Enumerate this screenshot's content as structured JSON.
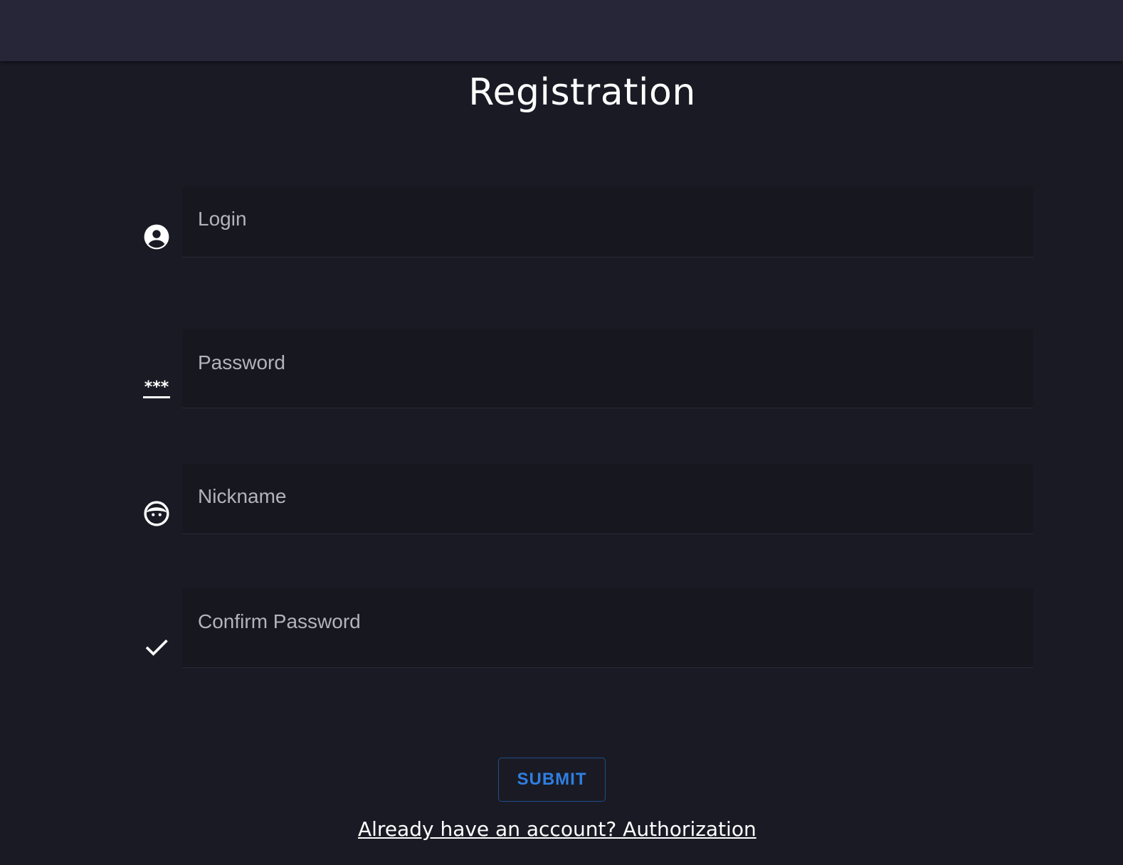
{
  "page": {
    "title": "Registration"
  },
  "form": {
    "fields": [
      {
        "label": "Login",
        "icon": "account-circle-icon"
      },
      {
        "label": "Password",
        "icon": "password-icon"
      },
      {
        "label": "Nickname",
        "icon": "face-icon"
      },
      {
        "label": "Confirm Password",
        "icon": "check-icon"
      }
    ],
    "submit_label": "SUBMIT",
    "auth_link": "Already have an account? Authorization"
  },
  "colors": {
    "background": "#1a1a25",
    "top_bar": "#262638",
    "field_background": "#171720",
    "accent": "#2f7fe0"
  }
}
